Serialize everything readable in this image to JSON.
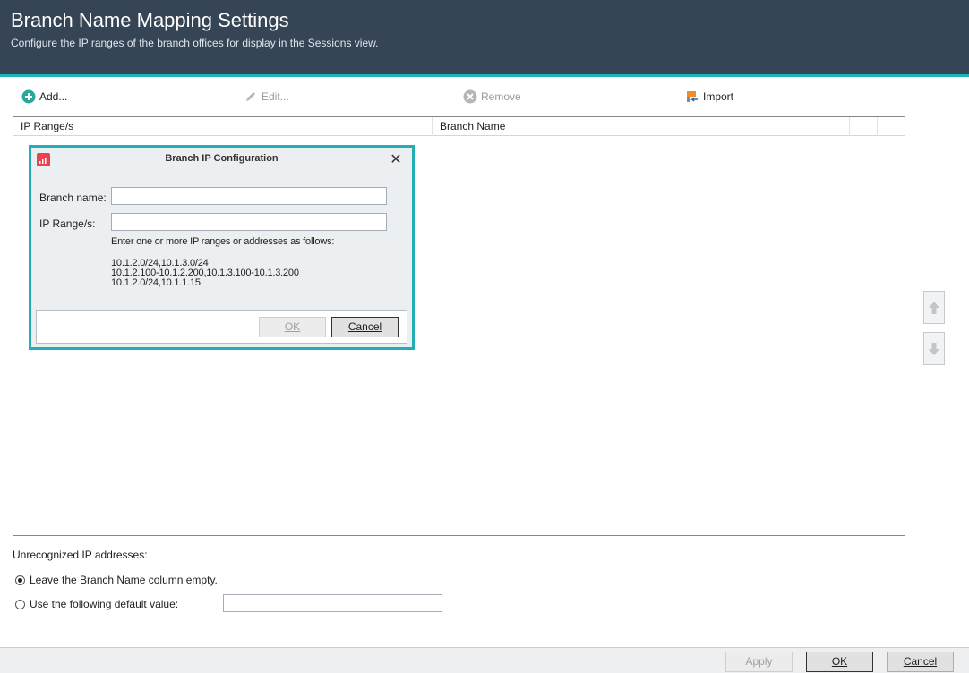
{
  "header": {
    "title": "Branch Name Mapping Settings",
    "subtitle": "Configure the IP ranges of the branch offices for display in the Sessions view."
  },
  "toolbar": {
    "add_label": "Add...",
    "edit_label": "Edit...",
    "remove_label": "Remove",
    "import_label": "Import"
  },
  "grid": {
    "columns": [
      "IP Range/s",
      "Branch Name"
    ]
  },
  "dialog": {
    "title": "Branch IP Configuration",
    "branch_name_label": "Branch name:",
    "branch_name_value": "",
    "ip_ranges_label": "IP Range/s:",
    "ip_ranges_value": "",
    "hint_intro": "Enter one or more IP ranges or addresses as follows:",
    "examples": [
      "10.1.2.0/24,10.1.3.0/24",
      "10.1.2.100-10.1.2.200,10.1.3.100-10.1.3.200",
      "10.1.2.0/24,10.1.1.15"
    ],
    "ok_label": "OK",
    "cancel_label": "Cancel"
  },
  "unrecognized": {
    "heading": "Unrecognized IP addresses:",
    "option_empty": "Leave the Branch Name column empty.",
    "option_default": "Use the following default value:",
    "default_value": "",
    "selected": "option_empty"
  },
  "footer": {
    "apply_label": "Apply",
    "ok_label": "OK",
    "cancel_label": "Cancel"
  },
  "colors": {
    "header_bg": "#364556",
    "accent": "#1fb4b4",
    "add_icon": "#2aa79b",
    "dialog_border": "#21aeb6"
  }
}
